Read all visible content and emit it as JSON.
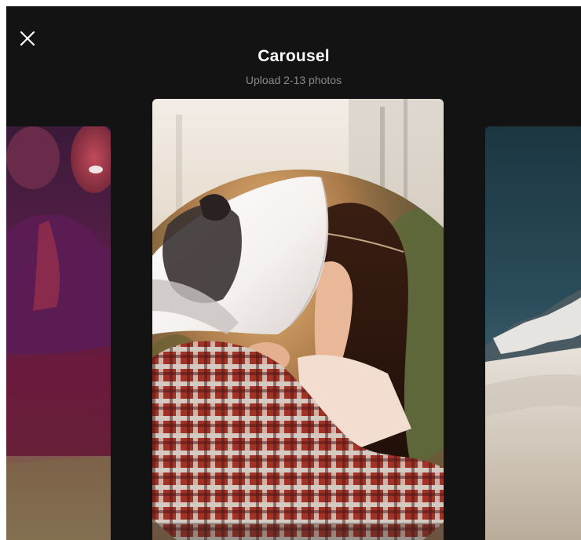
{
  "header": {
    "title": "Carousel",
    "subtitle": "Upload 2-13 photos"
  },
  "icons": {
    "close": "close-icon"
  },
  "carousel": {
    "items": [
      {
        "position": "previous",
        "description_id": "party-photo"
      },
      {
        "position": "current",
        "description_id": "woman-plaid-shirt-page-turn"
      },
      {
        "position": "next",
        "description_id": "snowy-mountain"
      }
    ]
  },
  "colors": {
    "background": "#131313",
    "title": "#ffffff",
    "subtitle": "#8a8a8a"
  }
}
